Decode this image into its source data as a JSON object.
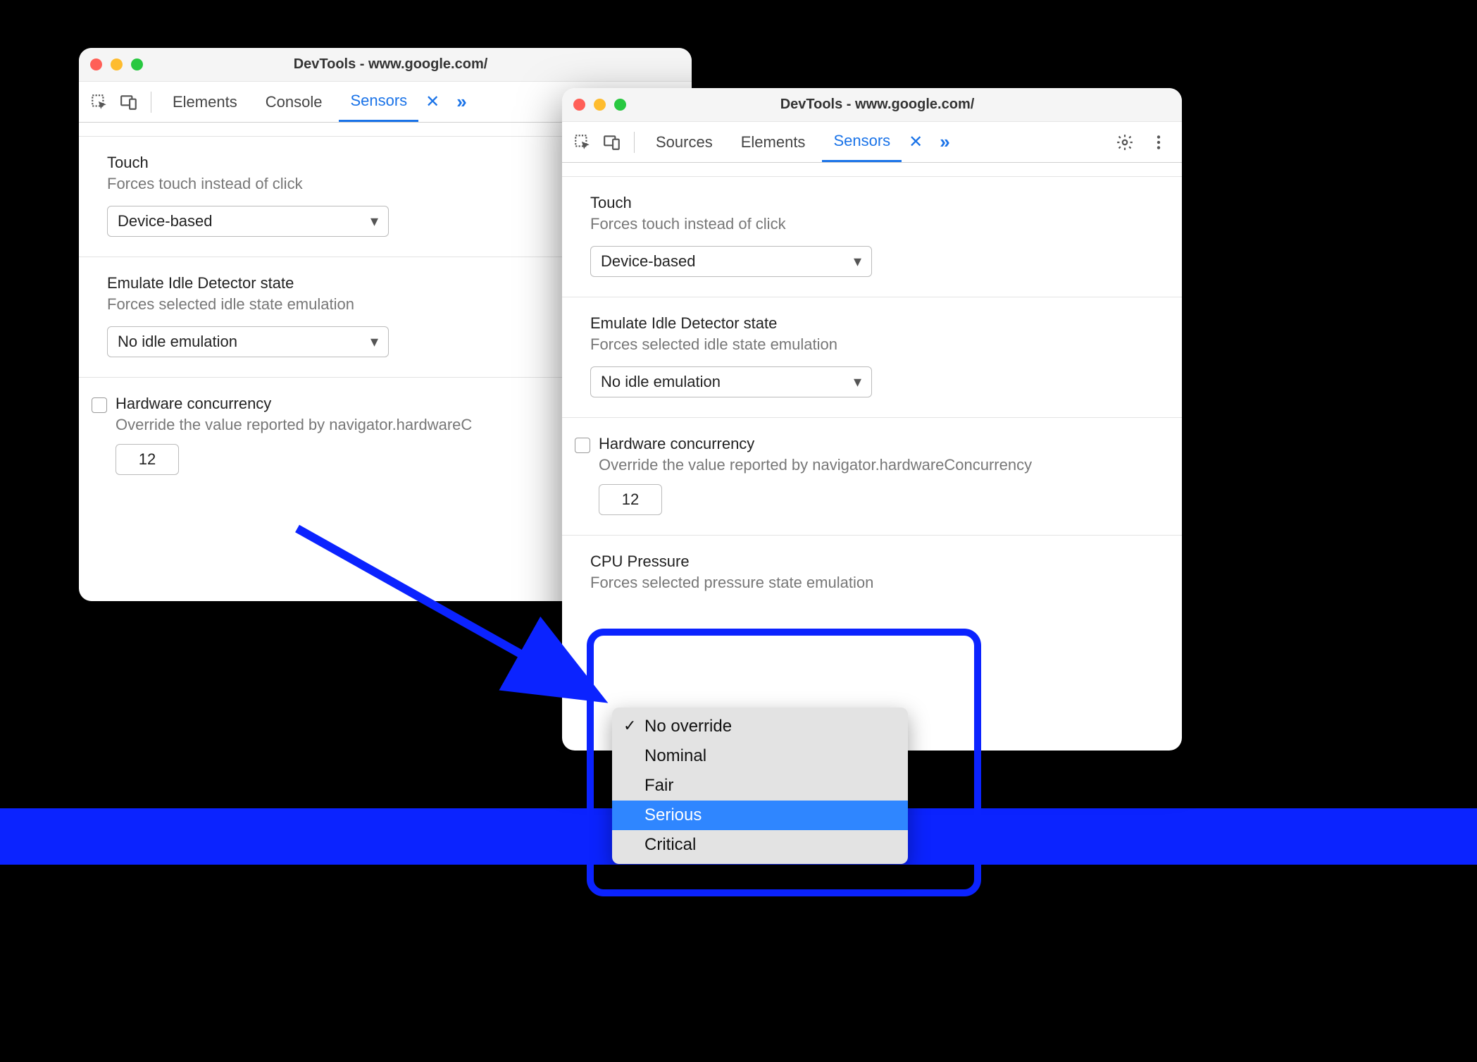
{
  "windows": {
    "left": {
      "title": "DevTools - www.google.com/",
      "tabs": {
        "t0": "Elements",
        "t1": "Console",
        "t2": "Sensors"
      },
      "touch": {
        "title": "Touch",
        "sub": "Forces touch instead of click",
        "value": "Device-based"
      },
      "idle": {
        "title": "Emulate Idle Detector state",
        "sub": "Forces selected idle state emulation",
        "value": "No idle emulation"
      },
      "hw": {
        "title": "Hardware concurrency",
        "sub": "Override the value reported by navigator.hardwareC",
        "value": "12"
      }
    },
    "right": {
      "title": "DevTools - www.google.com/",
      "tabs": {
        "t0": "Sources",
        "t1": "Elements",
        "t2": "Sensors"
      },
      "touch": {
        "title": "Touch",
        "sub": "Forces touch instead of click",
        "value": "Device-based"
      },
      "idle": {
        "title": "Emulate Idle Detector state",
        "sub": "Forces selected idle state emulation",
        "value": "No idle emulation"
      },
      "hw": {
        "title": "Hardware concurrency",
        "sub": "Override the value reported by navigator.hardwareConcurrency",
        "value": "12"
      },
      "pressure": {
        "title": "CPU Pressure",
        "sub": "Forces selected pressure state emulation",
        "options": {
          "o0": "No override",
          "o1": "Nominal",
          "o2": "Fair",
          "o3": "Serious",
          "o4": "Critical"
        }
      }
    }
  }
}
